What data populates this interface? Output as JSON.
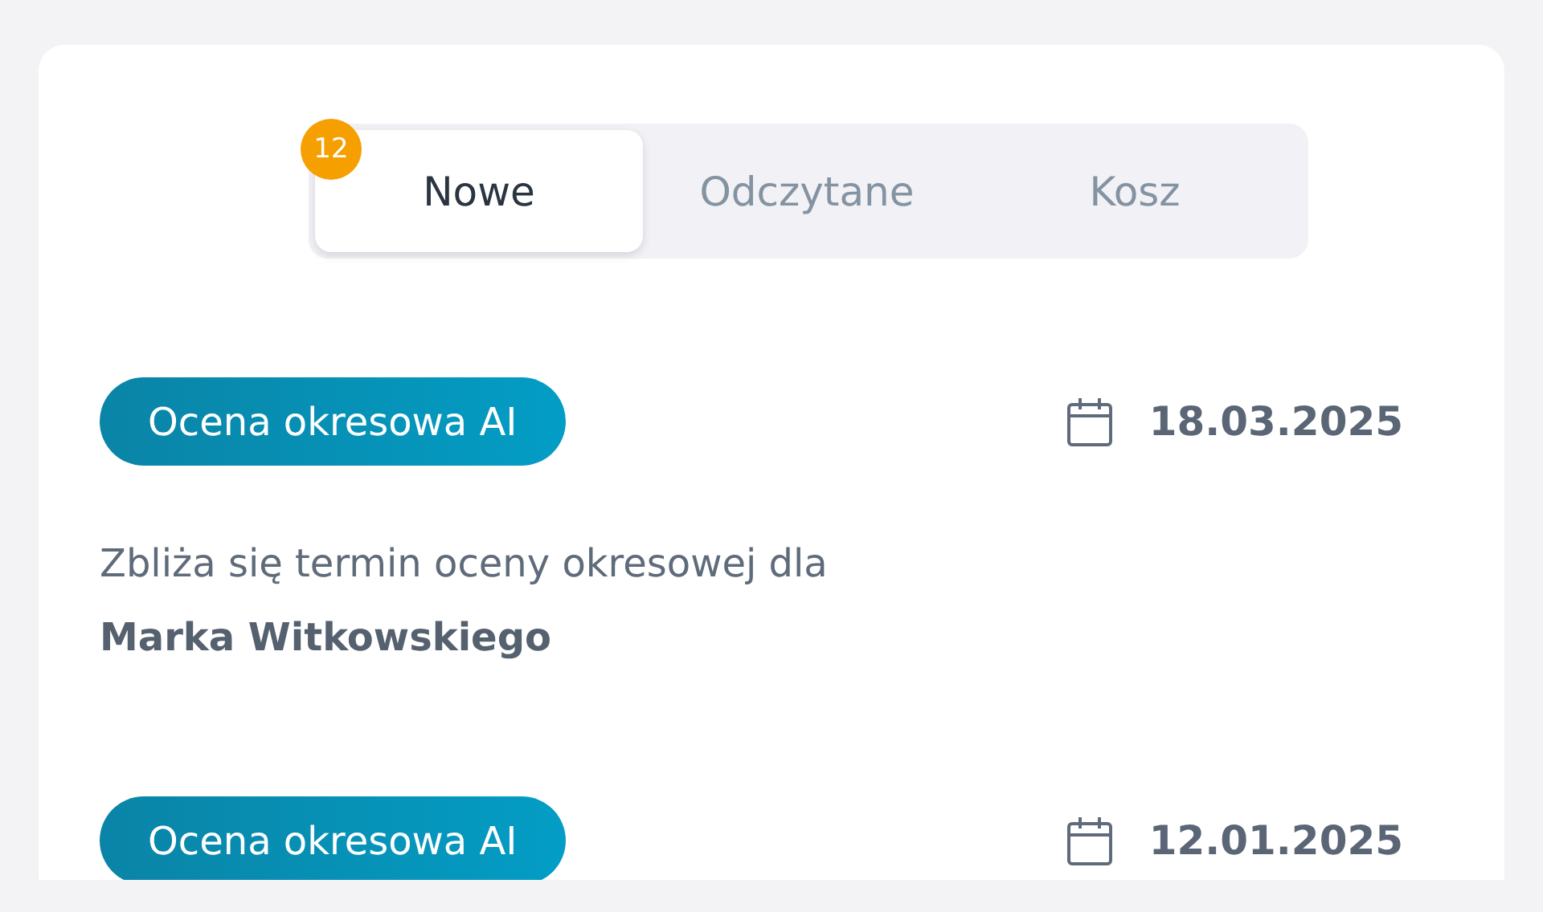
{
  "tabs": [
    {
      "label": "Nowe",
      "selected": true,
      "badge": "12"
    },
    {
      "label": "Odczytane",
      "selected": false
    },
    {
      "label": "Kosz",
      "selected": false
    }
  ],
  "notifications": [
    {
      "tag": "Ocena okresowa AI",
      "date": "18.03.2025",
      "message": "Zbliża się termin oceny okresowej dla **Marka Witkowskiego**"
    },
    {
      "tag": "Ocena okresowa AI",
      "date": "12.01.2025"
    }
  ]
}
